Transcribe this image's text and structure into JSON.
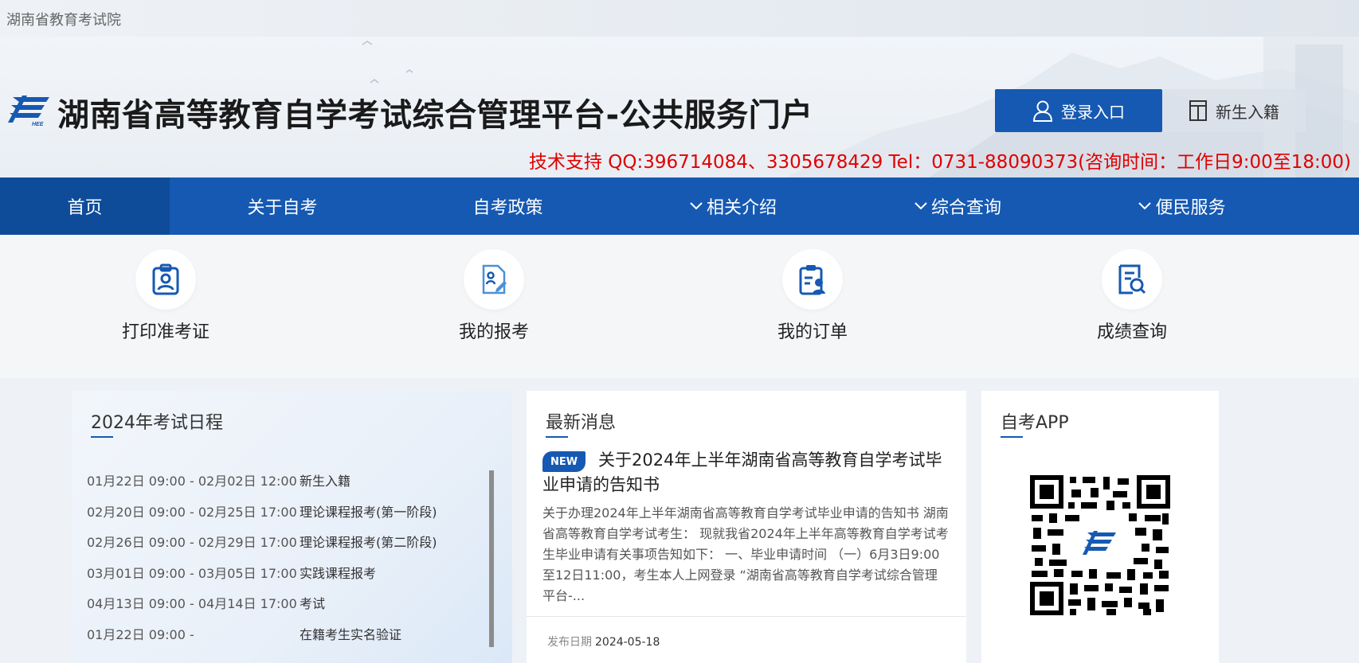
{
  "topbar": {
    "org": "湖南省教育考试院"
  },
  "header": {
    "title": "湖南省高等教育自学考试综合管理平台-公共服务门户",
    "login_label": "登录入口",
    "enroll_label": "新生入籍",
    "support": "技术支持 QQ:396714084、3305678429 Tel：0731-88090373(咨询时间：工作日9:00至18:00)",
    "logo_text": "HEE"
  },
  "nav": {
    "items": [
      {
        "label": "首页"
      },
      {
        "label": "关于自考"
      },
      {
        "label": "自考政策"
      },
      {
        "label": "相关介绍"
      },
      {
        "label": "综合查询"
      },
      {
        "label": "便民服务"
      }
    ]
  },
  "quick": {
    "items": [
      {
        "label": "打印准考证",
        "icon": "id-badge-icon"
      },
      {
        "label": "我的报考",
        "icon": "document-edit-icon"
      },
      {
        "label": "我的订单",
        "icon": "clipboard-user-icon"
      },
      {
        "label": "成绩查询",
        "icon": "document-search-icon"
      }
    ]
  },
  "schedule": {
    "title": "2024年考试日程",
    "rows": [
      {
        "time": "01月22日 09:00 - 02月02日 12:00",
        "event": "新生入籍"
      },
      {
        "time": "02月20日 09:00 - 02月25日 17:00",
        "event": "理论课程报考(第一阶段)"
      },
      {
        "time": "02月26日 09:00 - 02月29日 17:00",
        "event": "理论课程报考(第二阶段)"
      },
      {
        "time": "03月01日 09:00 - 03月05日 17:00",
        "event": "实践课程报考"
      },
      {
        "time": "04月13日 09:00 - 04月14日 17:00",
        "event": "考试"
      },
      {
        "time": "01月22日 09:00 -",
        "event": "在籍考生实名验证"
      }
    ]
  },
  "news": {
    "title": "最新消息",
    "badge": "NEW",
    "headline": "关于2024年上半年湖南省高等教育自学考试毕业申请的告知书",
    "summary": "关于办理2024年上半年湖南省高等教育自学考试毕业申请的告知书 湖南省高等教育自学考试考生： 现就我省2024年上半年高等教育自学考试考生毕业申请有关事项告知如下： 一、毕业申请时间 （一）6月3日9:00至12日11:00，考生本人上网登录 “湖南省高等教育自学考试综合管理平台-...",
    "date_label": "发布日期",
    "date": "2024-05-18"
  },
  "app": {
    "title": "自考APP"
  },
  "colors": {
    "primary": "#1659b2",
    "nav_active": "#0e4c99",
    "support_red": "#e00000"
  }
}
